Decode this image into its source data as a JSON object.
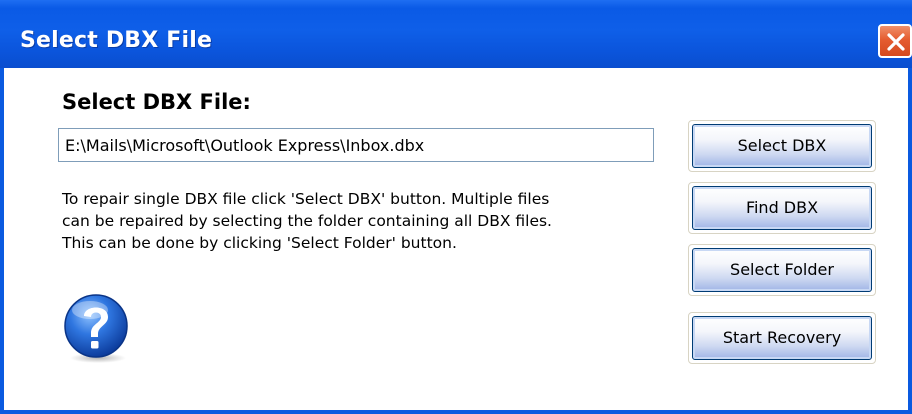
{
  "window": {
    "title": "Select DBX File",
    "close_icon": "close-icon"
  },
  "form": {
    "heading": "Select DBX File:",
    "path_value": "E:\\Mails\\Microsoft\\Outlook Express\\Inbox.dbx",
    "help_lines": [
      "To repair single DBX file click 'Select DBX' button. Multiple files",
      "can be repaired by selecting the folder containing all DBX files.",
      "This can be done by clicking 'Select Folder' button."
    ],
    "help_icon": "question-mark-icon"
  },
  "buttons": {
    "select_dbx": "Select DBX",
    "find_dbx": "Find DBX",
    "select_folder": "Select Folder",
    "start_recovery": "Start Recovery"
  },
  "colors": {
    "titlebar": "#0a5ae0",
    "close_button": "#e55c30",
    "button_border": "#003c74",
    "help_icon": "#1f5fd6"
  }
}
